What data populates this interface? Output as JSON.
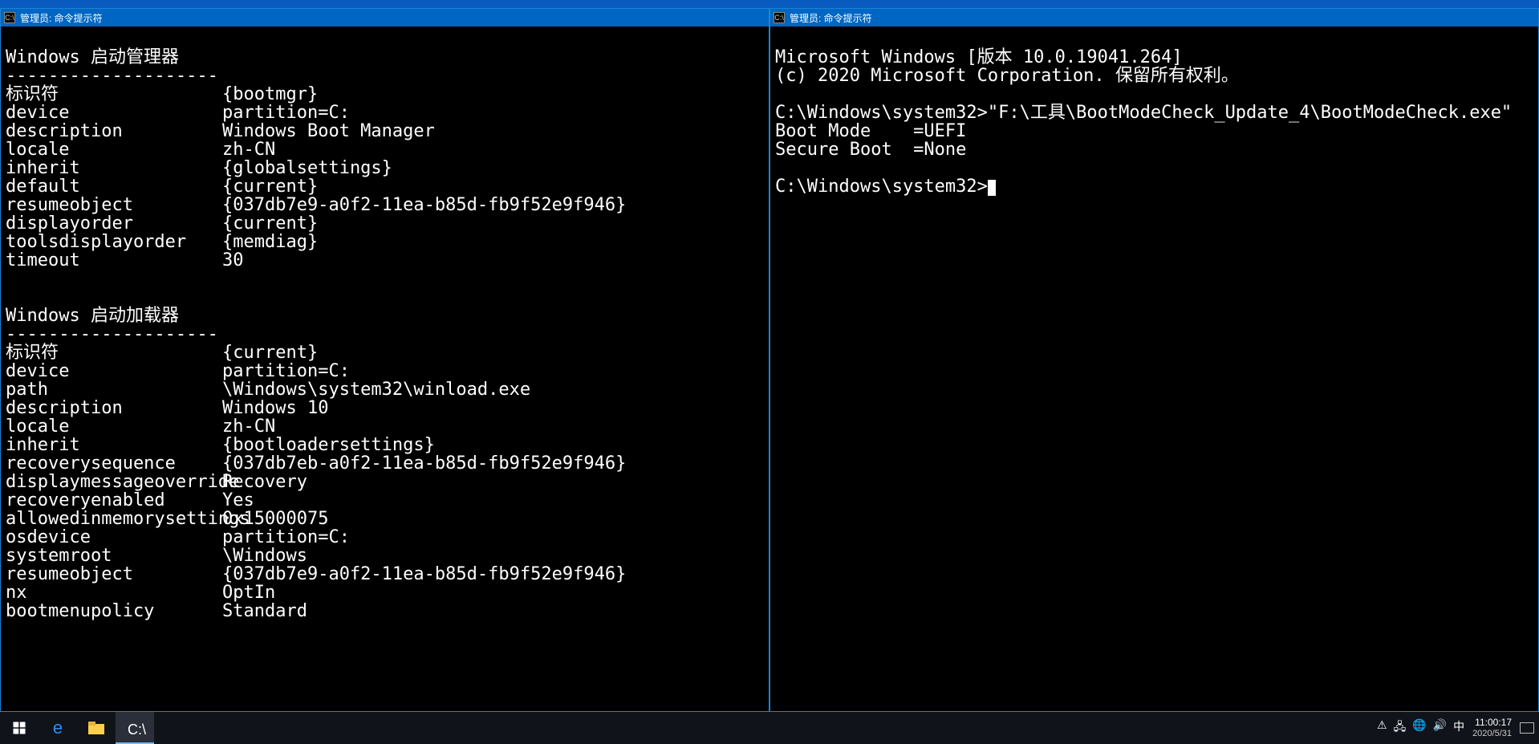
{
  "left_window": {
    "title": "管理员: 命令提示符",
    "section1": {
      "header": "Windows 启动管理器",
      "divider": "--------------------",
      "rows": [
        {
          "k": "标识符",
          "v": "{bootmgr}"
        },
        {
          "k": "device",
          "v": "partition=C:"
        },
        {
          "k": "description",
          "v": "Windows Boot Manager"
        },
        {
          "k": "locale",
          "v": "zh-CN"
        },
        {
          "k": "inherit",
          "v": "{globalsettings}"
        },
        {
          "k": "default",
          "v": "{current}"
        },
        {
          "k": "resumeobject",
          "v": "{037db7e9-a0f2-11ea-b85d-fb9f52e9f946}"
        },
        {
          "k": "displayorder",
          "v": "{current}"
        },
        {
          "k": "toolsdisplayorder",
          "v": "{memdiag}"
        },
        {
          "k": "timeout",
          "v": "30"
        }
      ]
    },
    "section2": {
      "header": "Windows 启动加载器",
      "divider": "--------------------",
      "rows": [
        {
          "k": "标识符",
          "v": "{current}"
        },
        {
          "k": "device",
          "v": "partition=C:"
        },
        {
          "k": "path",
          "v": "\\Windows\\system32\\winload.exe"
        },
        {
          "k": "description",
          "v": "Windows 10"
        },
        {
          "k": "locale",
          "v": "zh-CN"
        },
        {
          "k": "inherit",
          "v": "{bootloadersettings}"
        },
        {
          "k": "recoverysequence",
          "v": "{037db7eb-a0f2-11ea-b85d-fb9f52e9f946}"
        },
        {
          "k": "displaymessageoverride",
          "v": "Recovery"
        },
        {
          "k": "recoveryenabled",
          "v": "Yes"
        },
        {
          "k": "allowedinmemorysettings",
          "v": "0x15000075"
        },
        {
          "k": "osdevice",
          "v": "partition=C:"
        },
        {
          "k": "systemroot",
          "v": "\\Windows"
        },
        {
          "k": "resumeobject",
          "v": "{037db7e9-a0f2-11ea-b85d-fb9f52e9f946}"
        },
        {
          "k": "nx",
          "v": "OptIn"
        },
        {
          "k": "bootmenupolicy",
          "v": "Standard"
        }
      ]
    }
  },
  "right_window": {
    "title": "管理员: 命令提示符",
    "banner_line1": "Microsoft Windows [版本 10.0.19041.264]",
    "banner_line2": "(c) 2020 Microsoft Corporation. 保留所有权利。",
    "prompt1_path": "C:\\Windows\\system32>",
    "prompt1_cmd": "\"F:\\工具\\BootModeCheck_Update_4\\BootModeCheck.exe\"",
    "out1": "Boot Mode    =UEFI",
    "out2": "Secure Boot  =None",
    "prompt2": "C:\\Windows\\system32>"
  },
  "taskbar": {
    "clock_time": "11:00:17",
    "clock_date": "2020/5/31",
    "ime": "中"
  }
}
